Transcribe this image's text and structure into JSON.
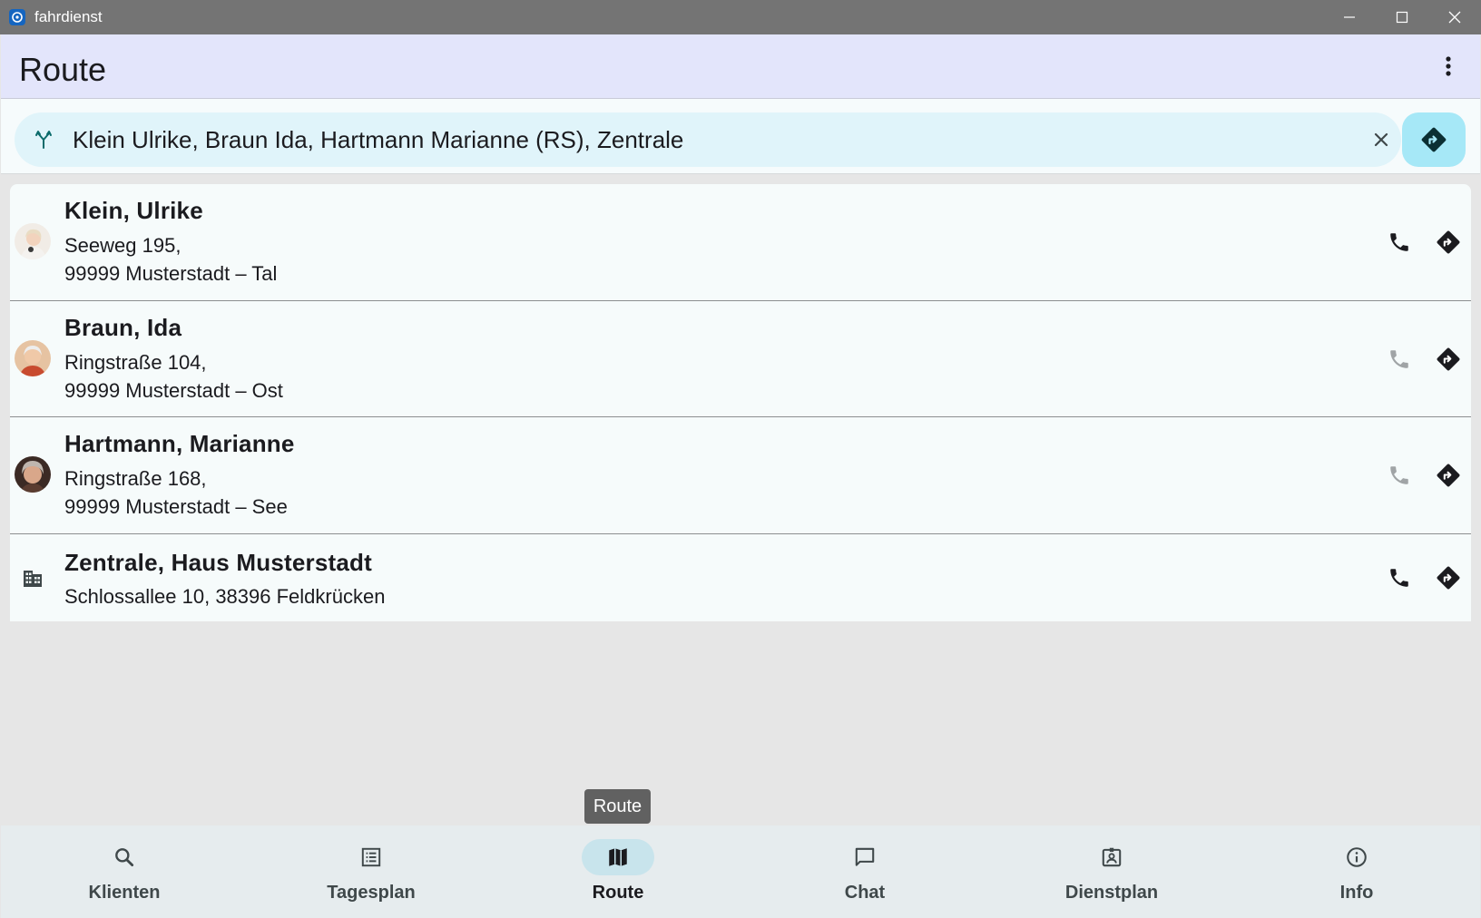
{
  "window": {
    "title": "fahrdienst",
    "controls": [
      "minimize-icon",
      "maximize-icon",
      "close-icon"
    ]
  },
  "appbar": {
    "title": "Route",
    "menu_icon": "more-vert-icon"
  },
  "route_bar": {
    "icon": "fork-icon",
    "text": "Klein Ulrike, Braun Ida, Hartmann Marianne (RS), Zentrale",
    "clear_icon": "close-icon",
    "go_icon": "directions-icon"
  },
  "stops": [
    {
      "name": "Klein, Ulrike",
      "address_line1": "Seeweg 195,",
      "address_line2": "99999 Musterstadt – Tal",
      "avatar": "photo",
      "phone_enabled": true
    },
    {
      "name": "Braun, Ida",
      "address_line1": "Ringstraße 104,",
      "address_line2": "99999 Musterstadt – Ost",
      "avatar": "photo",
      "phone_enabled": false
    },
    {
      "name": "Hartmann, Marianne",
      "address_line1": "Ringstraße 168,",
      "address_line2": "99999 Musterstadt – See",
      "avatar": "photo",
      "phone_enabled": false
    },
    {
      "name": "Zentrale, Haus Musterstadt",
      "address_line1": "Schlossallee 10, 38396 Feldkrücken",
      "avatar": "building-icon",
      "phone_enabled": true
    }
  ],
  "tooltip": "Route",
  "nav": [
    {
      "label": "Klienten",
      "icon": "search-icon",
      "active": false
    },
    {
      "label": "Tagesplan",
      "icon": "list-icon",
      "active": false
    },
    {
      "label": "Route",
      "icon": "map-icon",
      "active": true
    },
    {
      "label": "Chat",
      "icon": "chat-icon",
      "active": false
    },
    {
      "label": "Dienstplan",
      "icon": "badge-icon",
      "active": false
    },
    {
      "label": "Info",
      "icon": "info-icon",
      "active": false
    }
  ],
  "colors": {
    "appbar": "#e3e5fb",
    "route_field": "#e0f4fa",
    "route_go": "#a6e8f7",
    "nav_active": "#c8e4ec",
    "phone_disabled": "#a0a4a6"
  }
}
